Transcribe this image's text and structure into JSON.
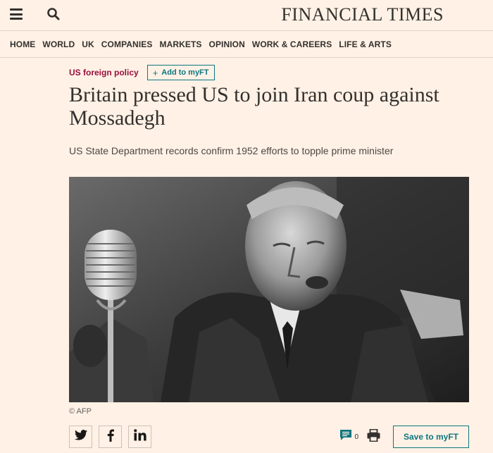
{
  "header": {
    "logo": "FINANCIAL TIMES",
    "menu_icon": "hamburger-menu-icon",
    "search_icon": "search-icon"
  },
  "nav": {
    "items": [
      "HOME",
      "WORLD",
      "UK",
      "COMPANIES",
      "MARKETS",
      "OPINION",
      "WORK & CAREERS",
      "LIFE & ARTS"
    ]
  },
  "article": {
    "topic": "US foreign policy",
    "add_myft": "Add to myFT",
    "headline": "Britain pressed US to join Iran coup against Mossadegh",
    "standfirst": "US State Department records confirm 1952 efforts to topple prime minister",
    "image_caption": "© AFP"
  },
  "share": {
    "icons": [
      "twitter-icon",
      "facebook-icon",
      "linkedin-icon"
    ]
  },
  "tools": {
    "comment_count": "0",
    "save_label": "Save to myFT"
  },
  "colors": {
    "background": "#fff1e5",
    "topic": "#990f3d",
    "teal": "#0d7680",
    "text": "#33302e"
  }
}
